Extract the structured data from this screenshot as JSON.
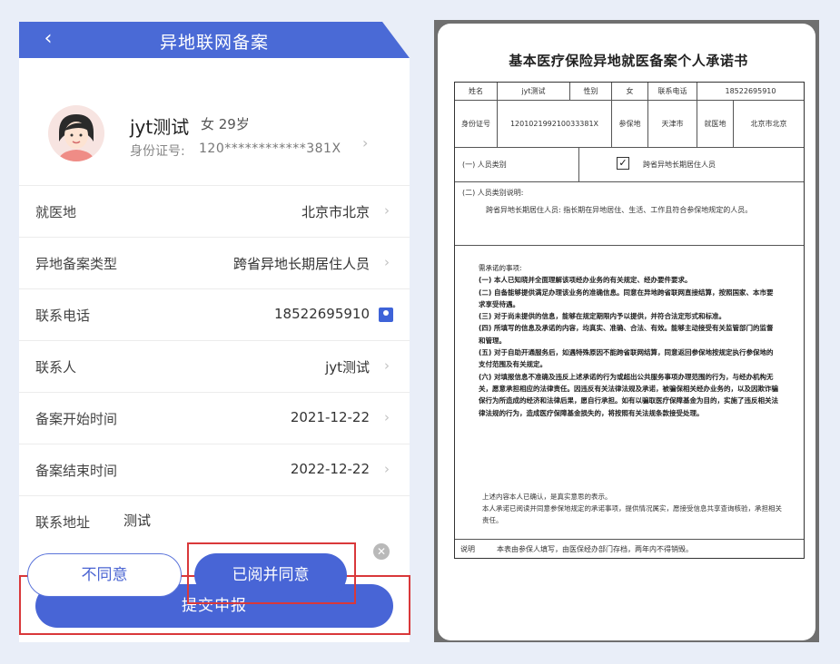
{
  "left": {
    "header": {
      "title": "异地联网备案",
      "back_icon": "‹"
    },
    "profile": {
      "name": "jyt测试",
      "meta": "女 29岁",
      "id_label": "身份证号:",
      "id_value": "120************381X"
    },
    "rows": [
      {
        "label": "就医地",
        "value": "北京市北京"
      },
      {
        "label": "异地备案类型",
        "value": "跨省异地长期居住人员"
      },
      {
        "label": "联系电话",
        "value": "18522695910"
      },
      {
        "label": "联系人",
        "value": "jyt测试"
      },
      {
        "label": "备案开始时间",
        "value": "2021-12-22"
      },
      {
        "label": "备案结束时间",
        "value": "2022-12-22"
      }
    ],
    "address": {
      "label": "联系地址",
      "value": "测试"
    },
    "submit_label": "提交申报"
  },
  "right": {
    "doc_title": "基本医疗保险异地就医备案个人承诺书",
    "table": {
      "row1": [
        "姓名",
        "jyt测试",
        "性别",
        "女",
        "联系电话",
        "18522695910"
      ],
      "row2": [
        "身份证号",
        "120102199210033381X",
        "参保地",
        "天津市",
        "就医地",
        "北京市北京"
      ],
      "person_type_label": "(一) 人员类别",
      "person_type_value": "跨省异地长期居住人员",
      "check": "✓",
      "note_title": "(二) 人员类别说明:",
      "note_body": "跨省异地长期居住人员: 指长期在异地居住、生活、工作且符合参保地规定的人员。",
      "promise_title": "需承诺的事项:",
      "promises": [
        "(一) 本人已知晓并全面理解该项经办业务的有关规定、经办要件要求。",
        "(二) 自备能够提供满足办理该业务的准确信息。同意在异地跨省联网直接结算，按照国家、本市要求享受待遇。",
        "(三) 对于尚未提供的信息，能够在规定期限内予以提供，并符合法定形式和标准。",
        "(四) 所填写的信息及承诺的内容，均真实、准确、合法、有效。能够主动接受有关监管部门的监督和管理。",
        "(五) 对于自助开通服务后，如遇特殊原因不能跨省联网结算，同意返回参保地按规定执行参保地的支付范围及有关规定。",
        "(六) 对填报信息不准确及违反上述承诺的行为或超出公共服务事项办理范围的行为，与经办机构无关，愿意承担相应的法律责任。因违反有关法律法规及承诺，被骗保相关经办业务的，以及因欺诈骗保行为所造成的经济和法律后果，愿自行承担。如有以骗取医疗保障基金为目的，实施了违反相关法律法规的行为，造成医疗保障基金损失的，将按照有关法规条款接受处理。"
      ],
      "closing": [
        "上述内容本人已确认，是真实意思的表示。",
        "本人承诺已阅读并同意参保地规定的承诺事项，提供情况属实，愿接受信息共享查询核验，承担相关责任。"
      ],
      "footer_label": "说明",
      "footer_text": "本表由参保人填写，由医保经办部门存档，两年内不得销毁。"
    },
    "disagree_label": "不同意",
    "agree_label": "已阅并同意"
  }
}
